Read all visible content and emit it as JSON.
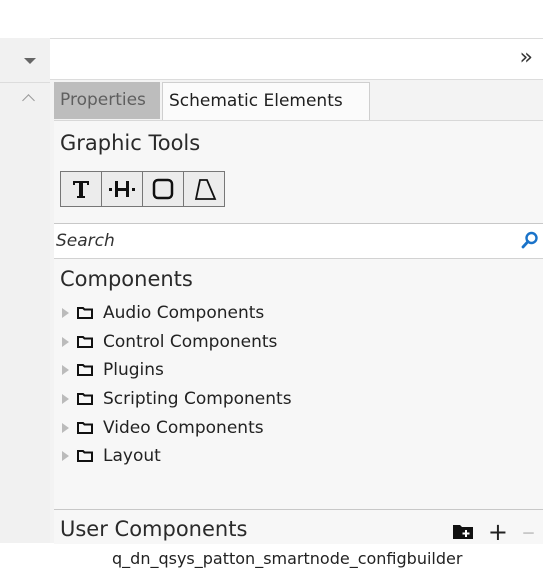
{
  "panel": {
    "collapse_glyph": "»"
  },
  "tabs": [
    {
      "label": "Properties",
      "active": false
    },
    {
      "label": "Schematic Elements",
      "active": true
    }
  ],
  "graphic_tools": {
    "title": "Graphic Tools",
    "tools": [
      {
        "icon": "text-tool-icon"
      },
      {
        "icon": "line-tool-icon"
      },
      {
        "icon": "rectangle-tool-icon"
      },
      {
        "icon": "polygon-tool-icon"
      }
    ]
  },
  "search": {
    "label": "Search",
    "icon": "search-icon"
  },
  "components": {
    "title": "Components",
    "items": [
      {
        "label": "Audio Components"
      },
      {
        "label": "Control Components"
      },
      {
        "label": "Plugins"
      },
      {
        "label": "Scripting Components"
      },
      {
        "label": "Video Components"
      },
      {
        "label": "Layout"
      }
    ]
  },
  "user_components": {
    "title": "User Components",
    "plus_glyph": "+",
    "minus_glyph": "–",
    "items": [
      {
        "label": "q_dn_qsys_patton_smartnode_configbuilder"
      }
    ]
  },
  "colors": {
    "accent": "#1a73c9",
    "inactive_tab": "#bdbdbd",
    "panel_bg": "#f7f7f7"
  }
}
